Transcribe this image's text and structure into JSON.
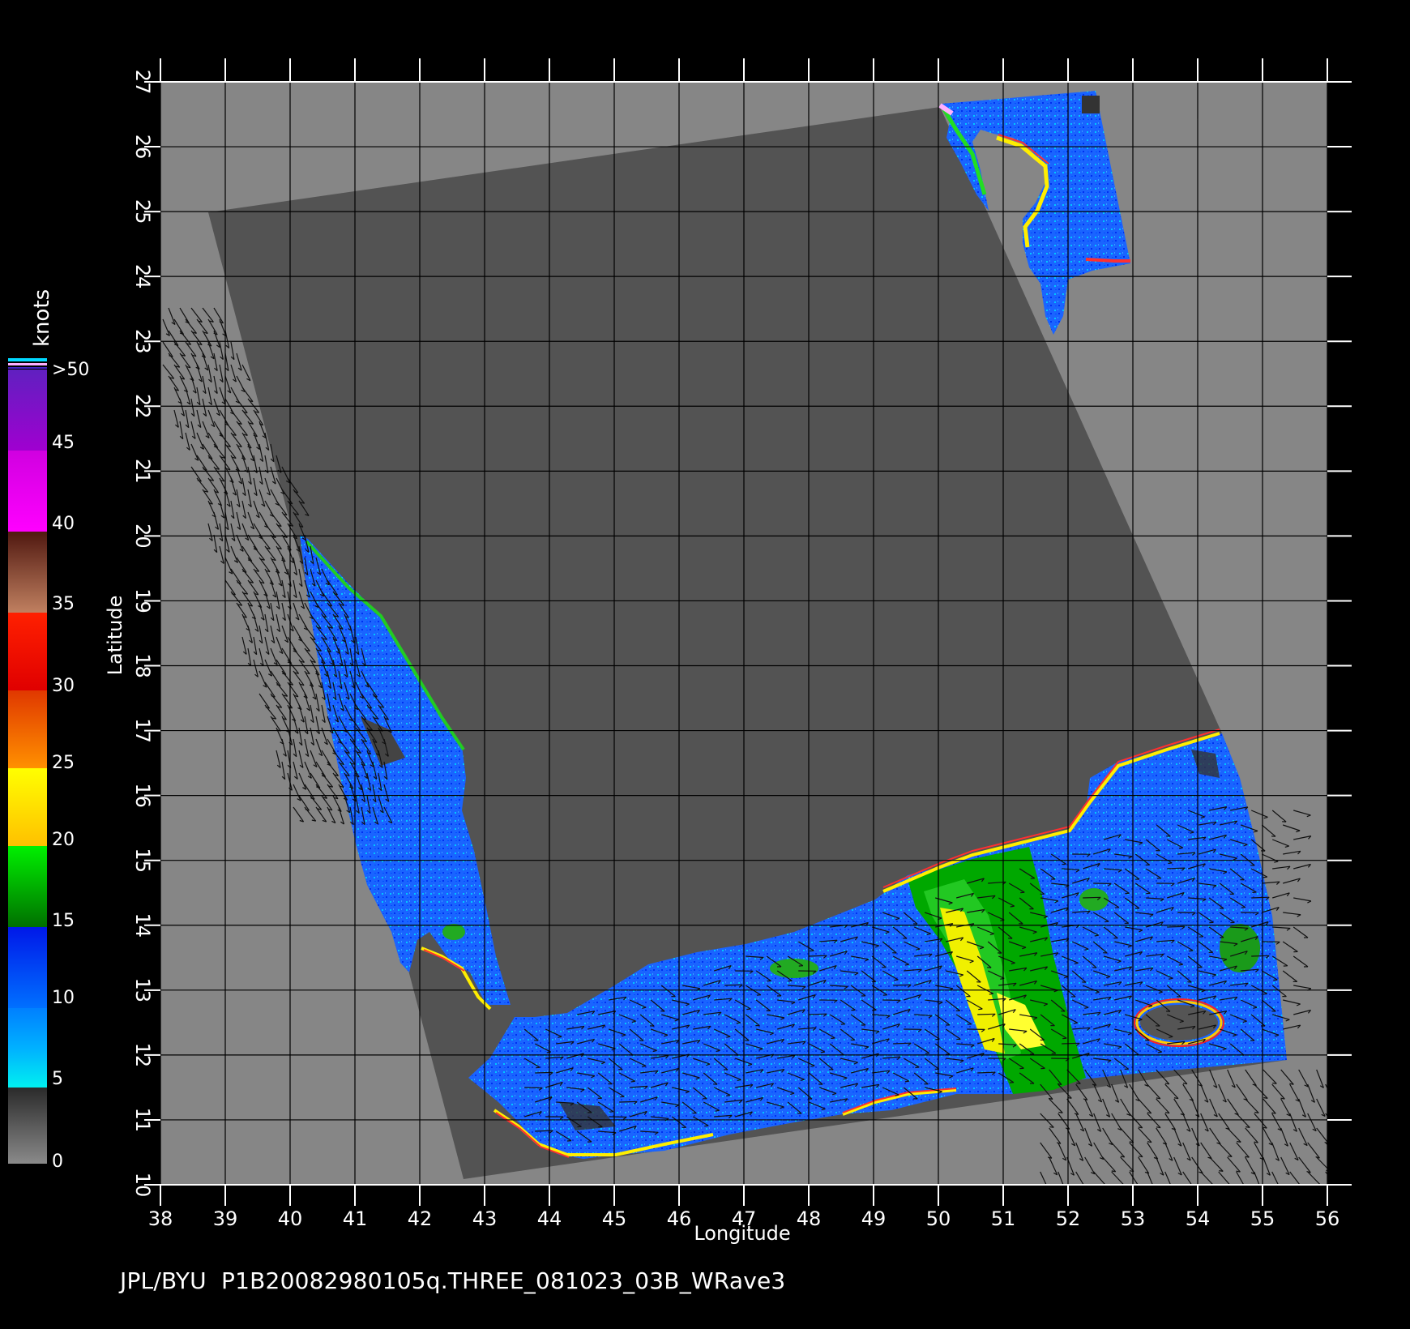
{
  "map": {
    "xlabel": "Longitude",
    "ylabel": "Latitude",
    "lon_ticks": [
      "38",
      "39",
      "40",
      "41",
      "42",
      "43",
      "44",
      "45",
      "46",
      "47",
      "48",
      "49",
      "50",
      "51",
      "52",
      "53",
      "54",
      "55",
      "56"
    ],
    "lat_ticks": [
      "10",
      "11",
      "12",
      "13",
      "14",
      "15",
      "16",
      "17",
      "18",
      "19",
      "20",
      "21",
      "22",
      "23",
      "24",
      "25",
      "26",
      "27"
    ],
    "lon_range": [
      38,
      56
    ],
    "lat_range": [
      10,
      27
    ]
  },
  "colorbar": {
    "unit": "knots",
    "labels": [
      ">50",
      "45",
      "40",
      "35",
      "30",
      "25",
      "20",
      "15",
      "10",
      "5",
      "0"
    ],
    "colors": {
      "0_5": [
        "#7a7a7a",
        "#2a2a2a"
      ],
      "5_10": [
        "#00f0f0",
        "#0090ff"
      ],
      "10_15": [
        "#0080ff",
        "#0018e8"
      ],
      "15_20": [
        "#00f000",
        "#007800"
      ],
      "20_25": [
        "#ffff00",
        "#ffc000"
      ],
      "25_30": [
        "#ff9000",
        "#e03000"
      ],
      "30_35": [
        "#ff2800",
        "#e00000"
      ],
      "35_40": [
        "#c08060",
        "#501810"
      ],
      "40_45": [
        "#ff00ff",
        "#d000e0"
      ],
      "45_50": [
        "#a000d0",
        "#6020c0"
      ]
    }
  },
  "colors": {
    "background": "#000000",
    "land": "#868686",
    "swath": "#535353",
    "grid": "#000000",
    "frame_ticks": "#ffffff"
  },
  "footer": "JPL/BYU  P1B20082980105q.THREE_081023_03B_WRave3"
}
